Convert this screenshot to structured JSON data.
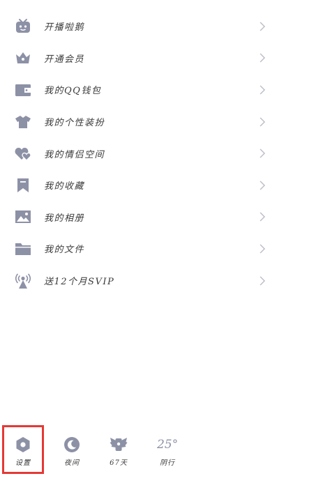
{
  "colors": {
    "icon": "#8d91a6",
    "text": "#3a3a3a",
    "chevron": "#b9bcc8",
    "highlight": "#e53935"
  },
  "menu": {
    "items": [
      {
        "label": "开播啦鹅",
        "icon": "tv-icon"
      },
      {
        "label": "开通会员",
        "icon": "crown-icon"
      },
      {
        "label": "我的QQ钱包",
        "icon": "wallet-icon"
      },
      {
        "label": "我的个性装扮",
        "icon": "tshirt-icon"
      },
      {
        "label": "我的情侣空间",
        "icon": "hearts-icon"
      },
      {
        "label": "我的收藏",
        "icon": "bookmark-icon"
      },
      {
        "label": "我的相册",
        "icon": "photo-icon"
      },
      {
        "label": "我的文件",
        "icon": "folder-icon"
      },
      {
        "label": "送12个月SVIP",
        "icon": "broadcast-icon"
      }
    ]
  },
  "bottom": {
    "settings_label": "设置",
    "night_label": "夜间",
    "days_label": "67天",
    "weather_label": "阴行",
    "weather_temp": "25°"
  }
}
